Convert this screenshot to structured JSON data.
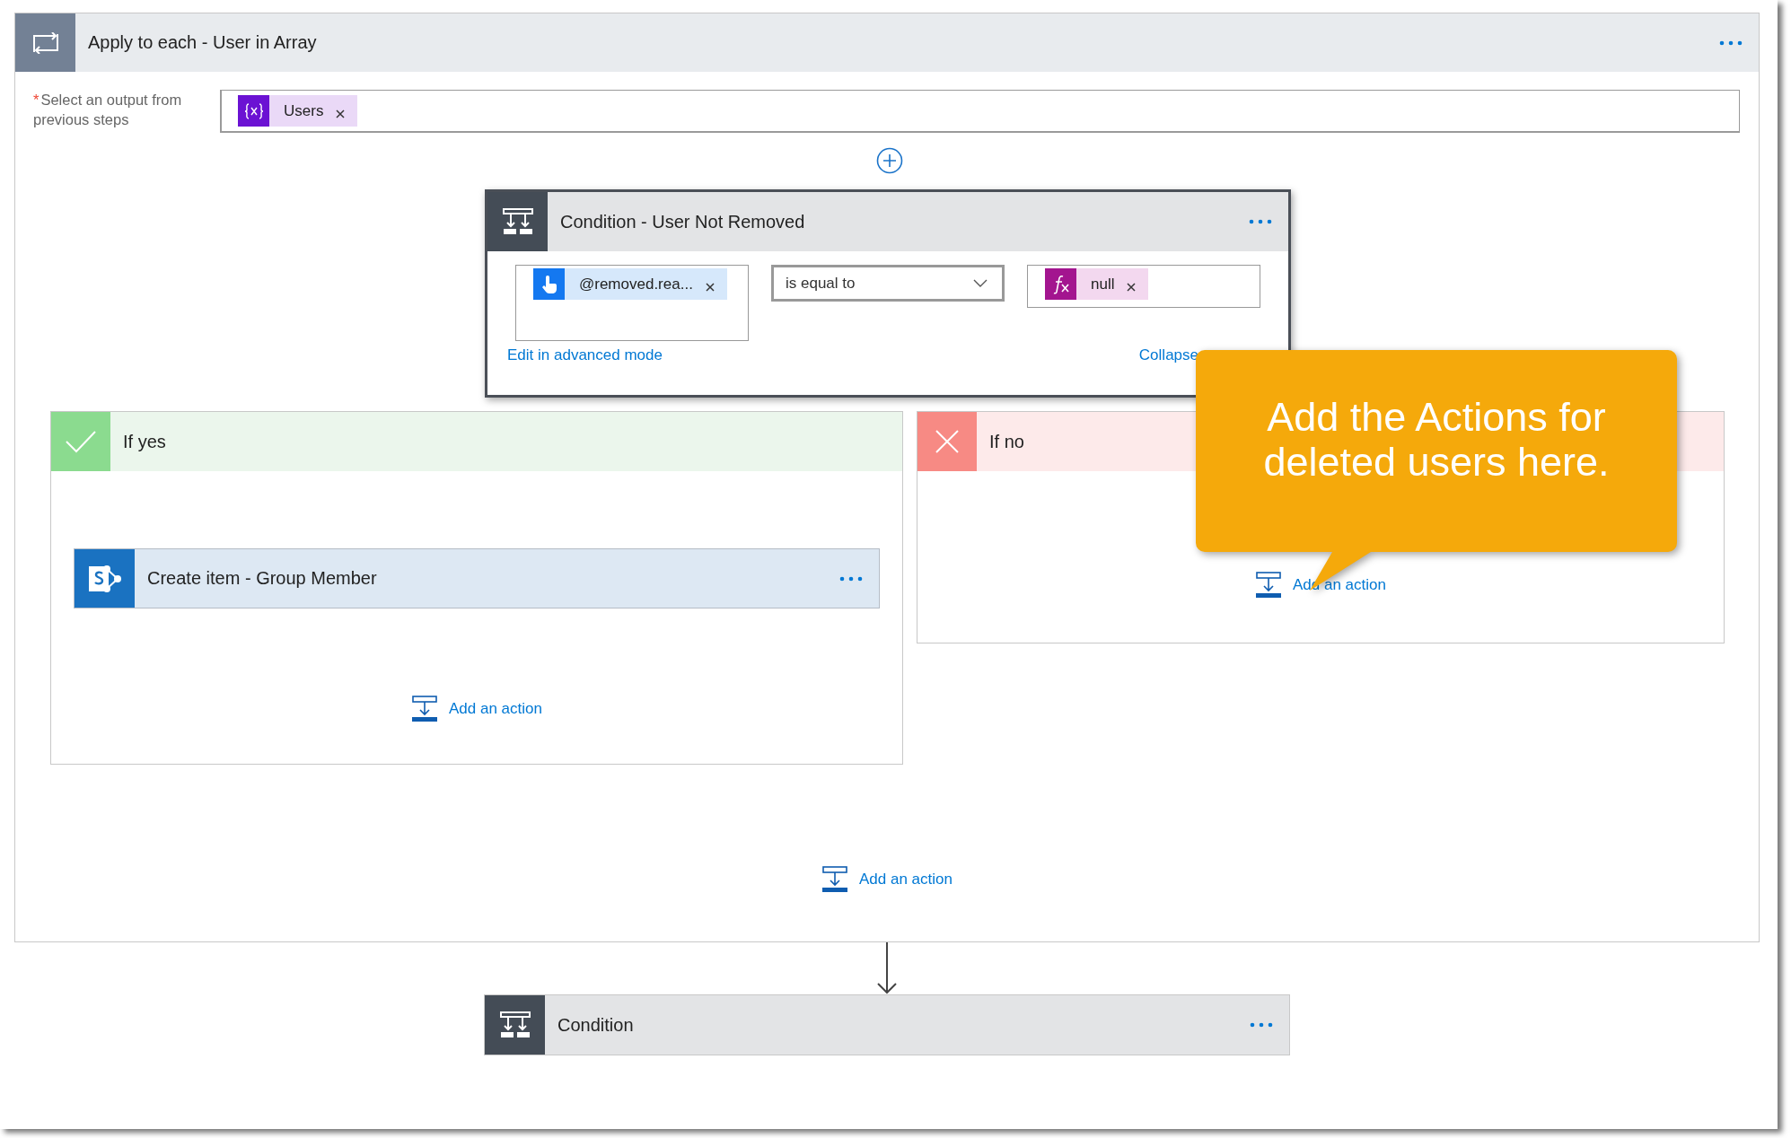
{
  "loop": {
    "title": "Apply to each - User in Array"
  },
  "output_field": {
    "required_mark": "*",
    "label": "Select an output from previous steps",
    "token": {
      "label": "Users",
      "kind": "variable"
    }
  },
  "condition": {
    "title": "Condition - User Not Removed",
    "left_token": {
      "label": "@removed.rea...",
      "kind": "trigger"
    },
    "operator": "is equal to",
    "right_token": {
      "label": "null",
      "kind": "expression"
    },
    "advanced_link": "Edit in advanced mode",
    "collapse_link": "Collapse"
  },
  "branches": [
    {
      "label": "If yes",
      "kind": "yes",
      "actions": [
        {
          "title": "Create item - Group Member",
          "kind": "sharepoint"
        }
      ],
      "add_action": "Add an action"
    },
    {
      "label": "If no",
      "kind": "no",
      "add_action": "Add an action"
    }
  ],
  "add_action": "Add an action",
  "next_step": {
    "title": "Condition"
  },
  "callout": {
    "text": "Add the Actions for deleted users here."
  }
}
